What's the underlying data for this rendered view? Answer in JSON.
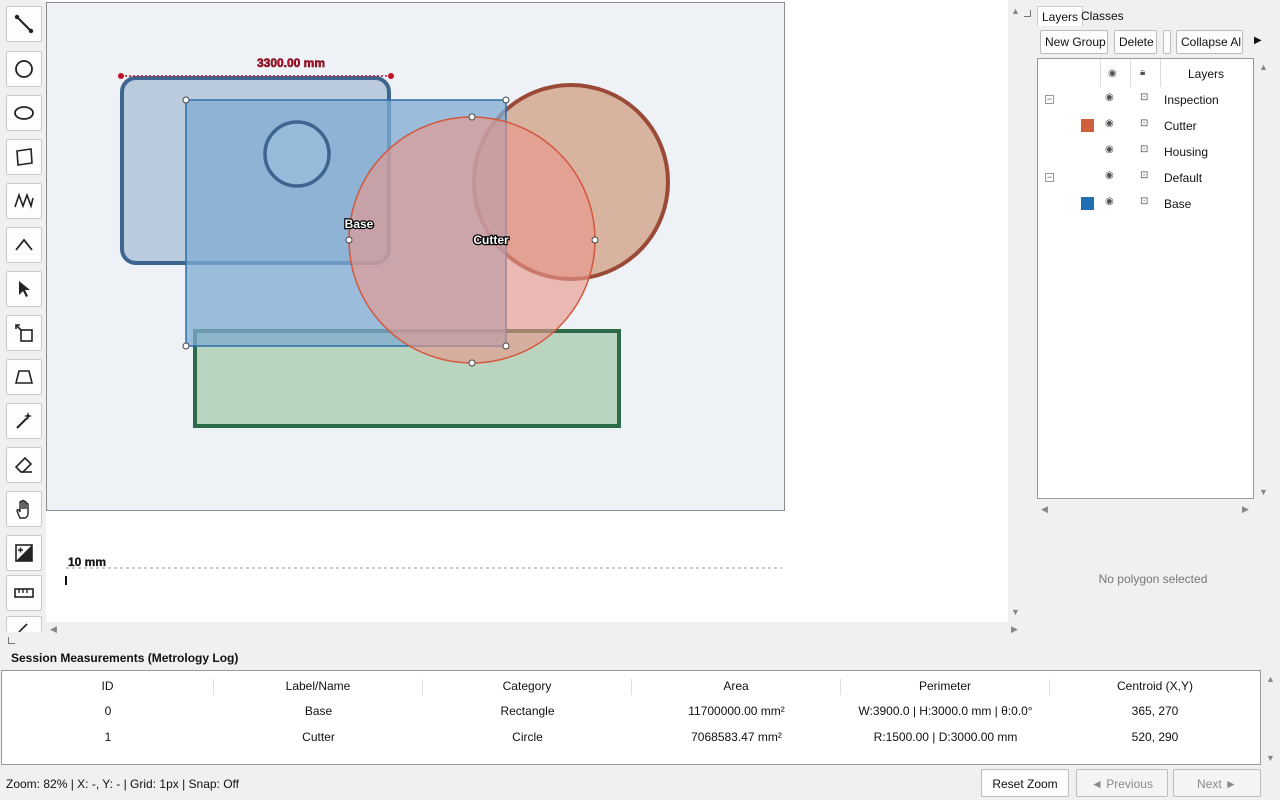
{
  "canvas": {
    "dimension_label": "3300.00 mm",
    "scale_label": "10 mm",
    "shape_labels": {
      "base": "Base",
      "cutter": "Cutter"
    }
  },
  "icons": {
    "tools": [
      "line-tool-icon",
      "circle-tool-icon",
      "ellipse-tool-icon",
      "polygon-tool-icon",
      "polyline-tool-icon",
      "angle-tool-icon",
      "select-arrow-icon",
      "transform-tool-icon",
      "perspective-tool-icon",
      "magic-wand-icon",
      "eraser-icon",
      "hand-pan-icon",
      "brightness-contrast-icon",
      "ruler-icon",
      "calibrate-icon"
    ]
  },
  "panel": {
    "tabs": [
      "Layers",
      "Classes"
    ],
    "buttons": {
      "new_group": "New Group",
      "delete": "Delete",
      "collapse": "Collapse Al",
      "more": "▶"
    },
    "tree_header": "Layers",
    "tree": [
      {
        "name": "Inspection",
        "expander": "−",
        "swatch": null
      },
      {
        "name": "Cutter",
        "expander": null,
        "swatch": "#d0603d"
      },
      {
        "name": "Housing",
        "expander": null,
        "swatch": null
      },
      {
        "name": "Default",
        "expander": "−",
        "swatch": null
      },
      {
        "name": "Base",
        "expander": null,
        "swatch": "#1f6fb2"
      }
    ],
    "empty_text": "No polygon selected"
  },
  "log": {
    "title": "Session Measurements (Metrology Log)",
    "columns": [
      "ID",
      "Label/Name",
      "Category",
      "Area",
      "Perimeter",
      "Centroid (X,Y)"
    ],
    "rows": [
      [
        "0",
        "Base",
        "Rectangle",
        "11700000.00 mm²",
        "W:3900.0 | H:3000.0 mm | θ:0.0°",
        "365, 270"
      ],
      [
        "1",
        "Cutter",
        "Circle",
        "7068583.47 mm²",
        "R:1500.00 | D:3000.00 mm",
        "520, 290"
      ]
    ]
  },
  "status": {
    "text": "Zoom: 82% | X: -, Y: - | Grid: 1px | Snap: Off",
    "reset_zoom": "Reset Zoom",
    "previous": "◄ Previous",
    "next": "Next ►"
  },
  "colors": {
    "base_fill": "#7fabd1",
    "cutter_fill": "#e8ada0",
    "housing_fill": "#b9d5bf",
    "inspection_fill": "#d8b4a0",
    "dimension_red": "#c0102a"
  }
}
